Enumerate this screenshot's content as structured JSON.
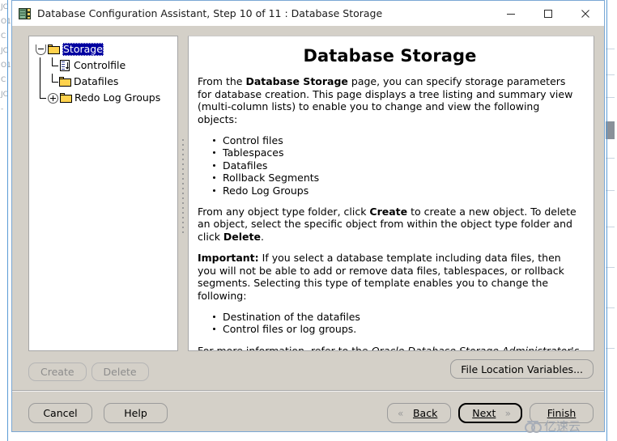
{
  "window": {
    "title": "Database Configuration Assistant, Step 10 of 11 : Database Storage",
    "app_icon": "database-icon",
    "controls": {
      "minimize": "minimize-icon",
      "maximize": "maximize-icon",
      "close": "close-icon"
    }
  },
  "tree": {
    "nodes": [
      {
        "label": "Storage",
        "icon": "folder-icon",
        "expander": "minus",
        "selected": true
      },
      {
        "label": "Controlfile",
        "icon": "controlfile-icon",
        "expander": "none",
        "selected": false
      },
      {
        "label": "Datafiles",
        "icon": "folder-icon",
        "expander": "none",
        "selected": false
      },
      {
        "label": "Redo Log Groups",
        "icon": "folder-icon",
        "expander": "plus",
        "selected": false
      }
    ]
  },
  "content": {
    "heading": "Database Storage",
    "paragraph1": {
      "pre": "From the ",
      "bold": "Database Storage",
      "post": " page, you can specify storage parameters for database creation. This page displays a tree listing and summary view (multi-column lists) to enable you to change and view the following objects:"
    },
    "list1": [
      "Control files",
      "Tablespaces",
      "Datafiles",
      "Rollback Segments",
      "Redo Log Groups"
    ],
    "paragraph2": {
      "pre": "From any object type folder, click ",
      "bold1": "Create",
      "mid": " to create a new object. To delete an object, select the specific object from within the object type folder and click ",
      "bold2": "Delete",
      "post": "."
    },
    "paragraph3": {
      "bold": "Important:",
      "text": " If you select a database template including data files, then you will not be able to add or remove data files, tablespaces, or rollback segments. Selecting this type of template enables you to change the following:"
    },
    "list2": [
      "Destination of the datafiles",
      "Control files or log groups."
    ],
    "paragraph4": {
      "pre": "For more information, refer to the ",
      "italic": "Oracle Database Storage Administrator's Guide",
      "post": "."
    }
  },
  "actions": {
    "create": "Create",
    "delete": "Delete",
    "file_location_variables": "File Location Variables..."
  },
  "nav": {
    "cancel": "Cancel",
    "help": "Help",
    "back": "Back",
    "back_mnemonic": "B",
    "next": "Next",
    "next_mnemonic": "N",
    "finish": "Finish",
    "finish_mnemonic": "F",
    "back_chevron": "«",
    "next_chevron": "»"
  },
  "watermark": {
    "text": "亿速云",
    "logo": "cloud-logo-icon"
  },
  "background_strip": {
    "left_lines": [
      "JC",
      "O1",
      "C",
      "JC",
      "O1",
      "C",
      "JC",
      "-"
    ]
  },
  "colors": {
    "dialog_face": "#d4d0c8",
    "titlebar": "#ffffff",
    "selection": "#0000a0",
    "folder": "#ffd24d",
    "window_border": "#7aa7d4",
    "panel_border": "#a6a6a6",
    "disabled_text": "#8c8c8c",
    "accent_line": "#5b9bd5"
  }
}
